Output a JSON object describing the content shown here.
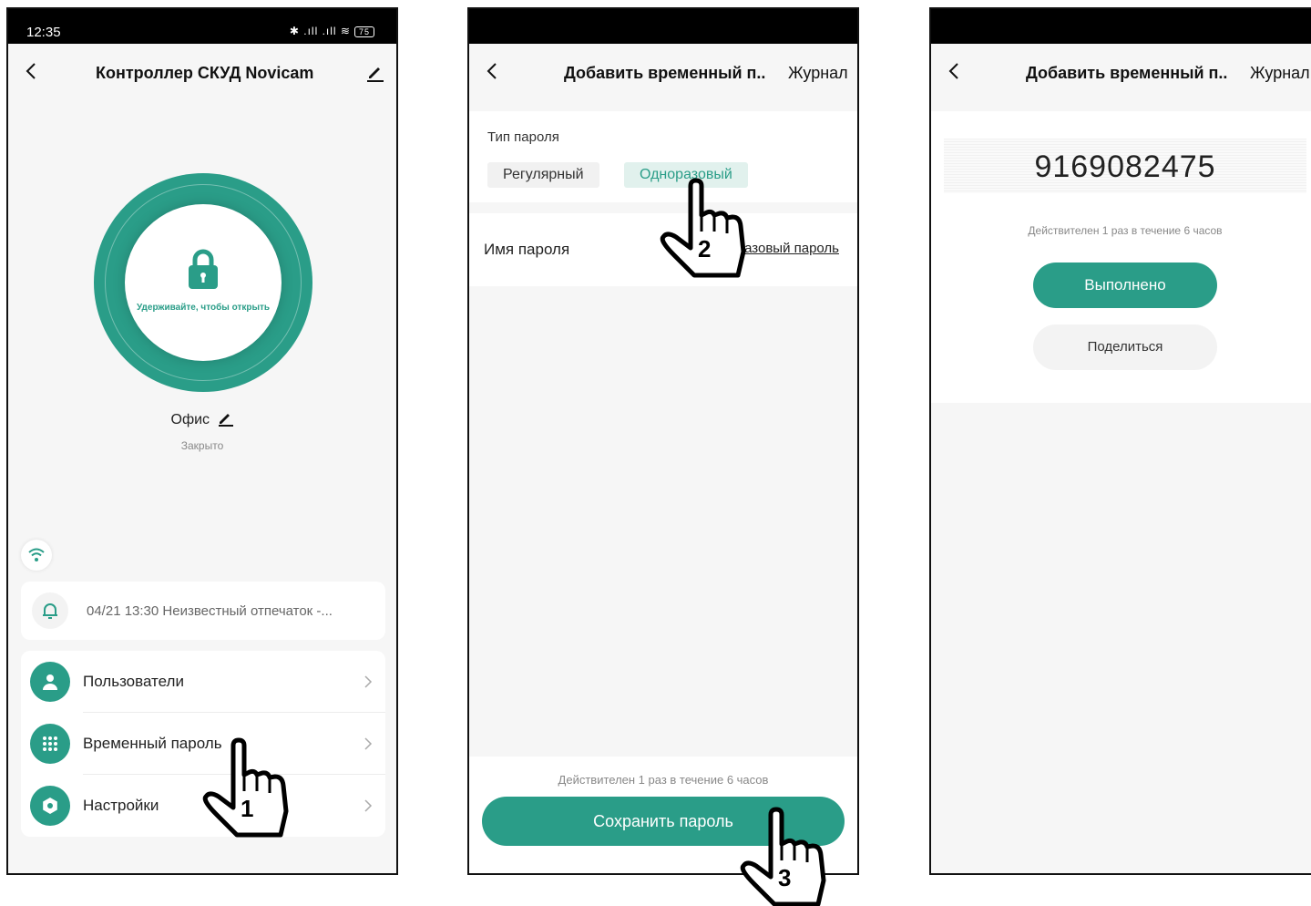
{
  "colors": {
    "accent": "#2a9d88",
    "accent_light": "#e1f1ed",
    "bg": "#f6f6f6"
  },
  "screen1": {
    "status": {
      "time": "12:35",
      "battery": "75"
    },
    "header": {
      "title": "Контроллер СКУД Novicam"
    },
    "lock": {
      "hold_text": "Удерживайте, чтобы открыть"
    },
    "device": {
      "name": "Офис",
      "state": "Закрыто"
    },
    "notification": {
      "text": "04/21 13:30   Неизвестный отпечаток -..."
    },
    "menu": [
      {
        "label": "Пользователи",
        "icon": "user-icon"
      },
      {
        "label": "Временный пароль",
        "icon": "keypad-icon"
      },
      {
        "label": "Настройки",
        "icon": "gear-icon"
      }
    ],
    "hand_number": "1"
  },
  "screen2": {
    "header": {
      "title": "Добавить временный п..",
      "journal": "Журнал"
    },
    "password_type": {
      "label": "Тип пароля",
      "options": [
        "Регулярный",
        "Одноразовый"
      ],
      "selected": "Одноразовый"
    },
    "password_name": {
      "label": "Имя пароля",
      "value": "Одноразовый пароль"
    },
    "validity": "Действителен 1 раз в течение 6 часов",
    "save_button": "Сохранить пароль",
    "hand_numbers": [
      "2",
      "3"
    ]
  },
  "screen3": {
    "header": {
      "title": "Добавить временный п..",
      "journal": "Журнал"
    },
    "code": "9169082475",
    "validity": "Действителен 1 раз в течение 6 часов",
    "done_button": "Выполнено",
    "share_button": "Поделиться"
  }
}
